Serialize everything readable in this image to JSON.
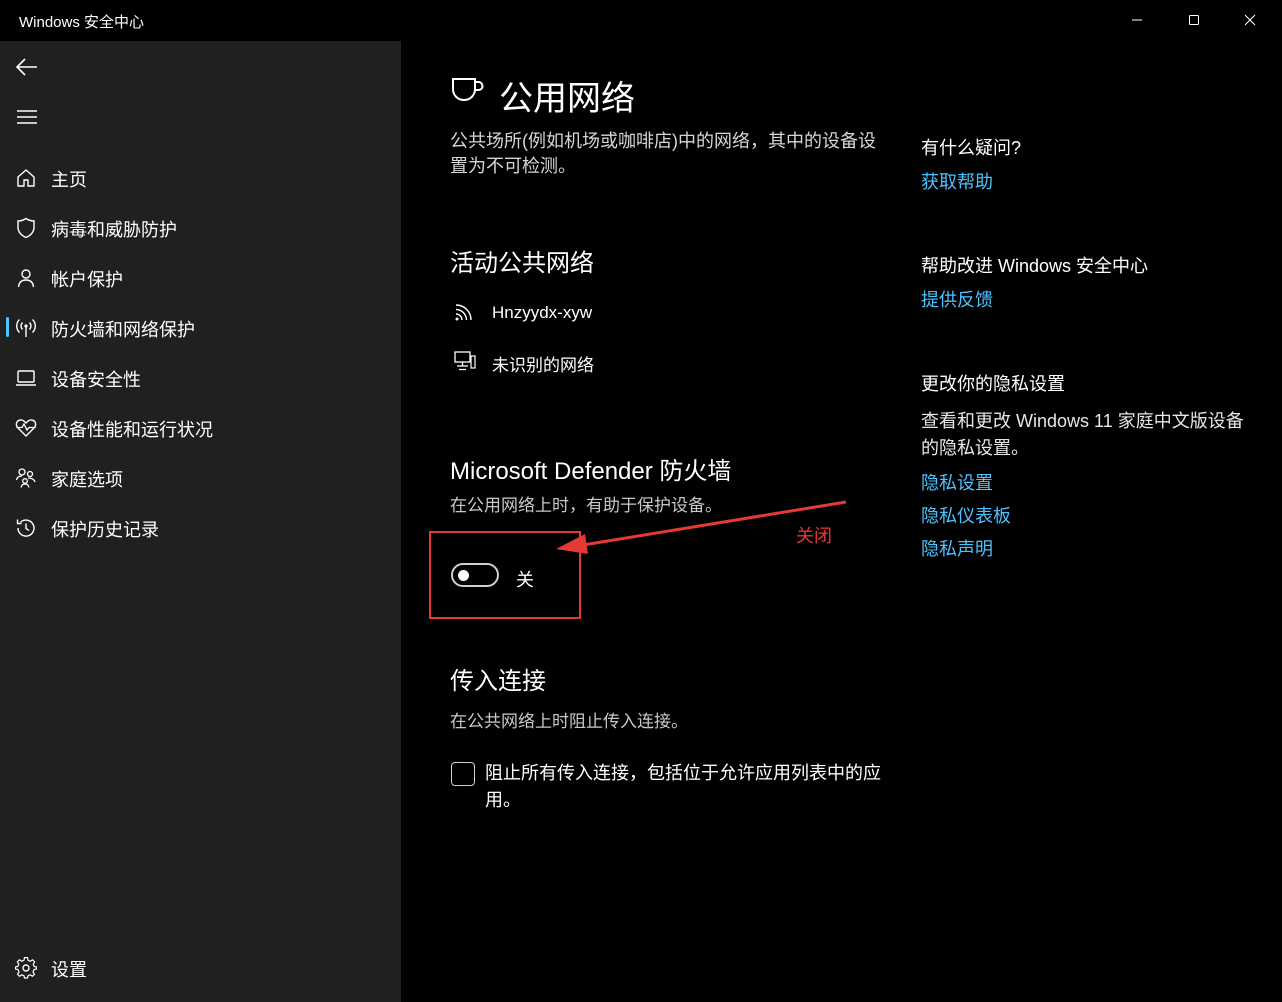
{
  "window": {
    "title": "Windows 安全中心",
    "controls": [
      "minimize-icon",
      "maximize-icon",
      "close-icon"
    ]
  },
  "sidebar": {
    "back_icon": "back-arrow-icon",
    "menu_icon": "hamburger-icon",
    "items": [
      {
        "label": "主页",
        "icon": "home-icon"
      },
      {
        "label": "病毒和威胁防护",
        "icon": "shield-icon"
      },
      {
        "label": "帐户保护",
        "icon": "person-icon"
      },
      {
        "label": "防火墙和网络保护",
        "icon": "antenna-icon",
        "selected": true
      },
      {
        "label": "设备安全性",
        "icon": "laptop-icon"
      },
      {
        "label": "设备性能和运行状况",
        "icon": "heart-pulse-icon"
      },
      {
        "label": "家庭选项",
        "icon": "family-icon"
      },
      {
        "label": "保护历史记录",
        "icon": "history-icon"
      }
    ],
    "settings": {
      "label": "设置",
      "icon": "gear-icon"
    }
  },
  "main": {
    "title": "公用网络",
    "title_icon": "coffee-cup-icon",
    "description": "公共场所(例如机场或咖啡店)中的网络，其中的设备设置为不可检测。",
    "active_networks": {
      "heading": "活动公共网络",
      "items": [
        {
          "name": "Hnzyydx-xyw",
          "icon": "wifi-icon"
        },
        {
          "name": "未识别的网络",
          "icon": "wired-network-icon"
        }
      ]
    },
    "firewall": {
      "heading": "Microsoft Defender 防火墙",
      "subtitle": "在公用网络上时，有助于保护设备。",
      "toggle_state": "关",
      "toggle_on": false
    },
    "incoming": {
      "heading": "传入连接",
      "subtitle": "在公共网络上时阻止传入连接。",
      "checkbox_label": "阻止所有传入连接，包括位于允许应用列表中的应用。",
      "checked": false
    }
  },
  "right_panel": {
    "questions": {
      "heading": "有什么疑问?",
      "link": "获取帮助"
    },
    "improve": {
      "heading": "帮助改进 Windows 安全中心",
      "link": "提供反馈"
    },
    "privacy": {
      "heading": "更改你的隐私设置",
      "text": "查看和更改 Windows 11 家庭中文版设备的隐私设置。",
      "links": [
        "隐私设置",
        "隐私仪表板",
        "隐私声明"
      ]
    }
  },
  "annotation": {
    "label": "关闭",
    "color": "#e53935"
  },
  "colors": {
    "accent": "#4cc2ff",
    "sidebar_bg": "#202020",
    "content_bg": "#000000"
  }
}
